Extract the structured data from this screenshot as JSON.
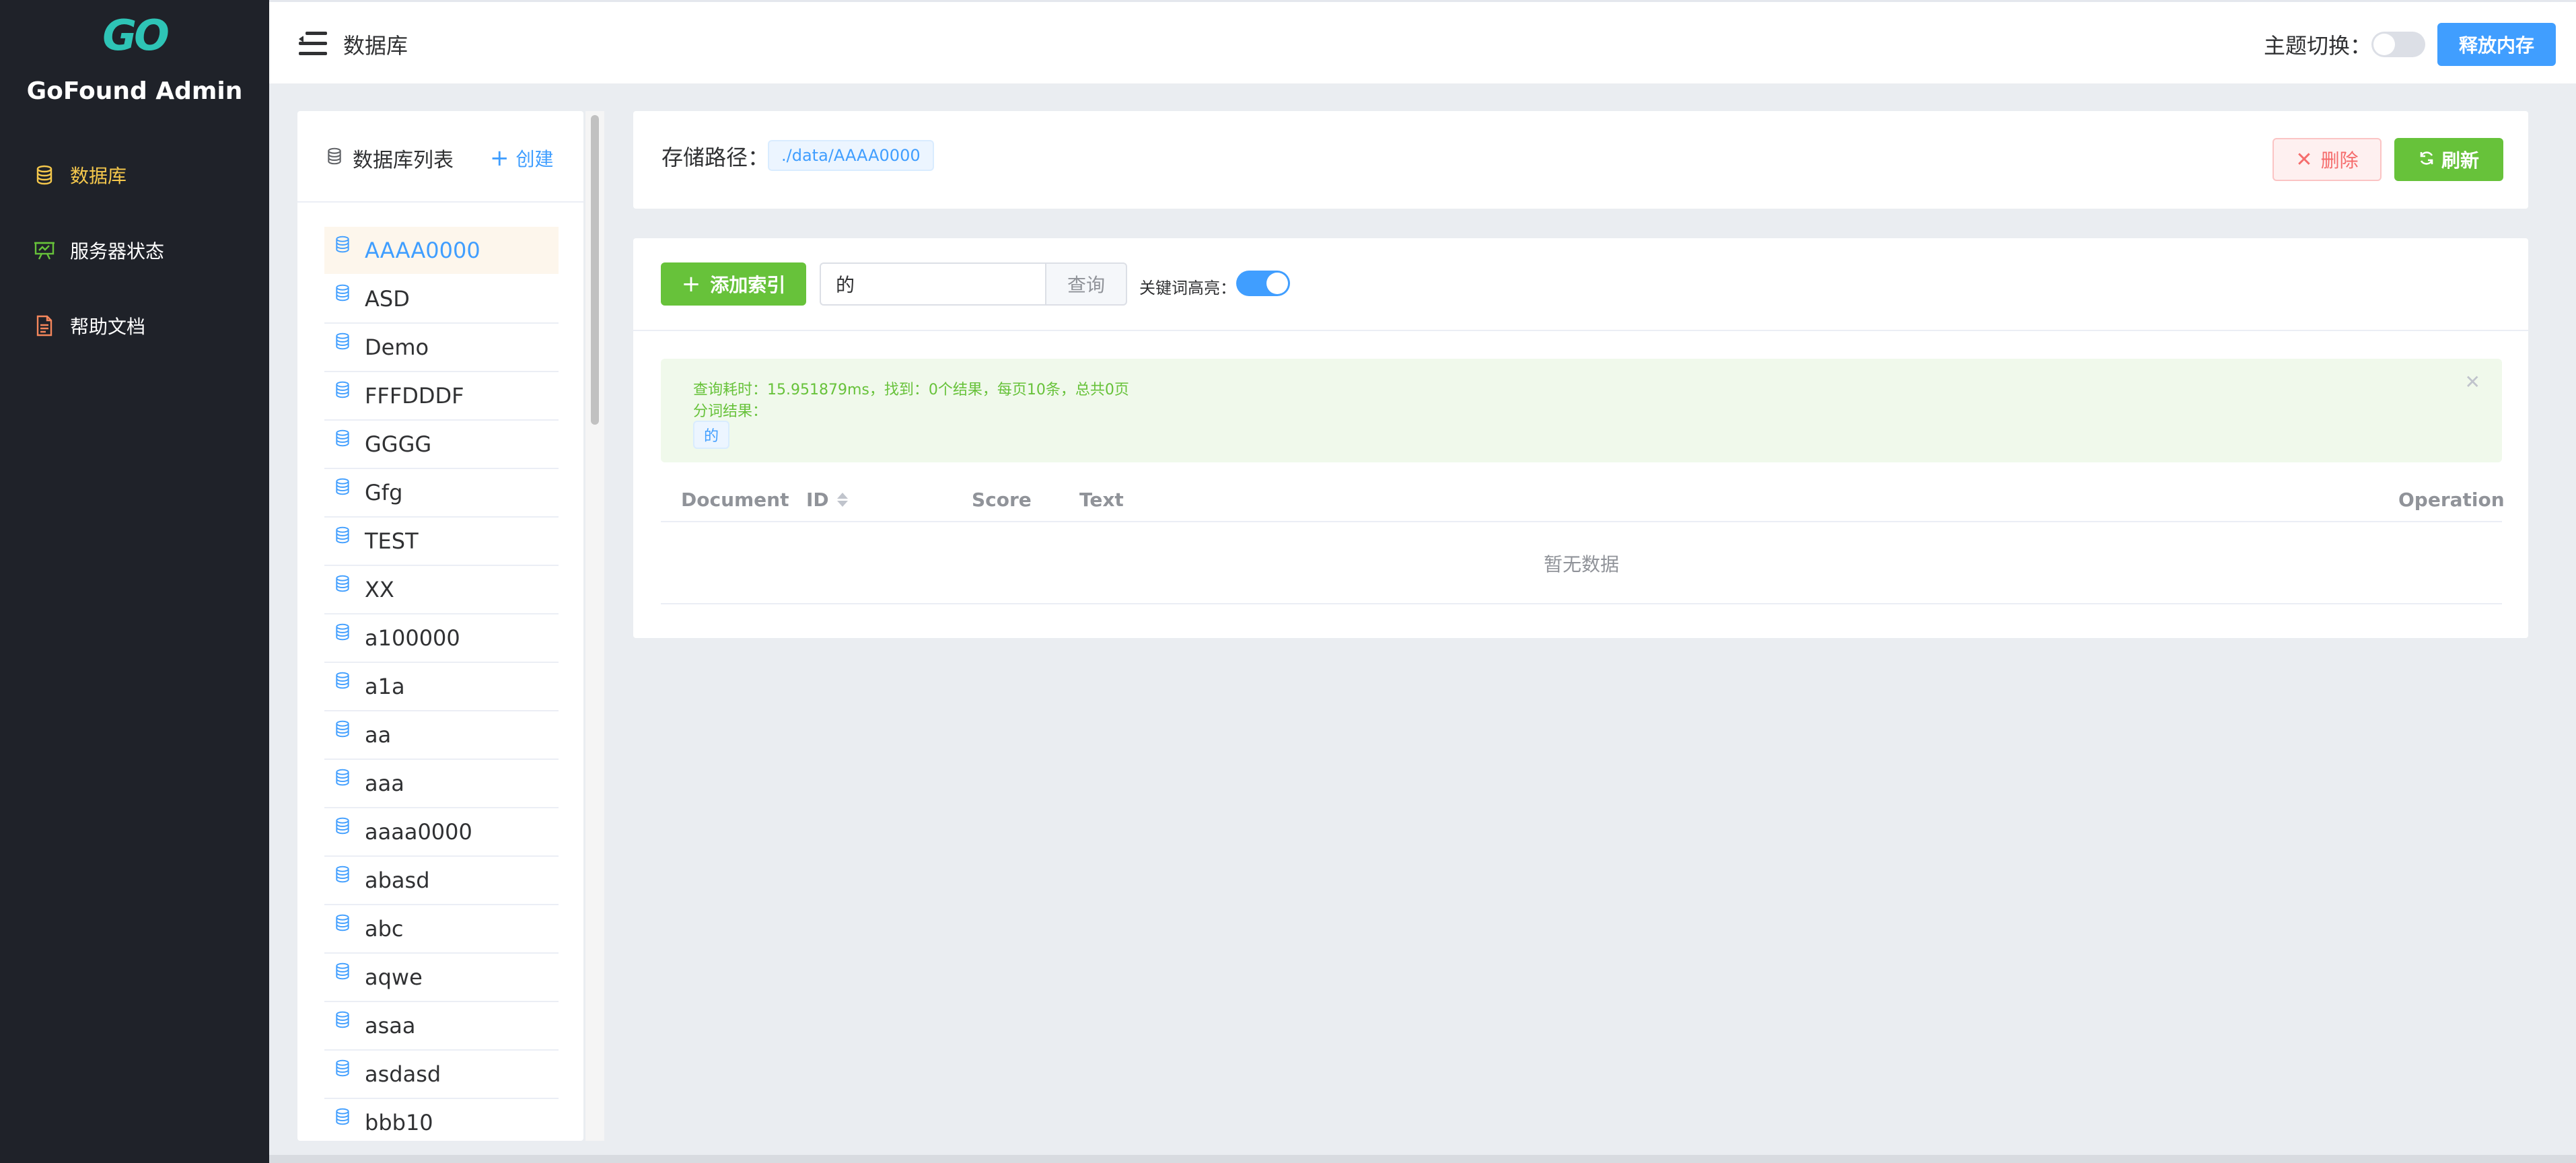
{
  "app": {
    "logo_text": "GO",
    "title": "GoFound Admin"
  },
  "sidebar": {
    "items": [
      {
        "label": "数据库",
        "icon": "database-icon",
        "active": true
      },
      {
        "label": "服务器状态",
        "icon": "chart-board-icon",
        "active": false
      },
      {
        "label": "帮助文档",
        "icon": "document-icon",
        "active": false
      }
    ]
  },
  "header": {
    "page_title": "数据库",
    "theme_label": "主题切换：",
    "theme_dark": false,
    "release_memory_label": "释放内存"
  },
  "db_panel": {
    "title": "数据库列表",
    "create_label": "创建",
    "items": [
      "AAAA0000",
      "ASD",
      "Demo",
      "FFFDDDF",
      "GGGG",
      "Gfg",
      "TEST",
      "XX",
      "a100000",
      "a1a",
      "aa",
      "aaa",
      "aaaa0000",
      "abasd",
      "abc",
      "aqwe",
      "asaa",
      "asdasd",
      "bbb10"
    ],
    "selected": "AAAA0000"
  },
  "path_card": {
    "label": "存储路径：",
    "path": "./data/AAAA0000",
    "delete_label": "删除",
    "refresh_label": "刷新"
  },
  "search": {
    "add_index_label": "添加索引",
    "query_value": "的",
    "query_button_label": "查询",
    "highlight_label": "关键词高亮：",
    "highlight_on": true
  },
  "result_alert": {
    "summary": "查询耗时：15.951879ms，找到：0个结果，每页10条，总共0页",
    "tokens_label": "分词结果：",
    "tokens": [
      "的"
    ]
  },
  "table": {
    "columns": [
      "Document",
      "ID",
      "Score",
      "Text",
      "Operation"
    ],
    "empty_text": "暂无数据"
  },
  "colors": {
    "sidebar_bg": "#1f2229",
    "active_menu": "#f5c84c",
    "primary": "#409eff",
    "success": "#67c23a",
    "danger": "#f56c6c",
    "logo": "#2ec4b6"
  }
}
